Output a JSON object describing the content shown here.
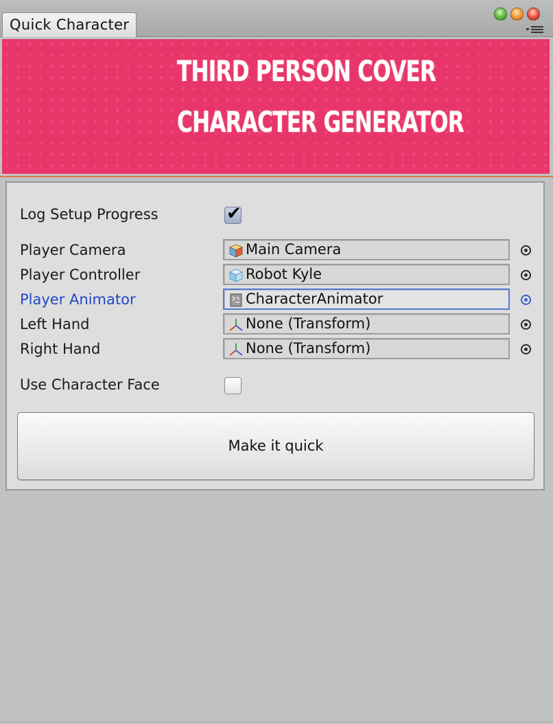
{
  "window": {
    "tab_title": "Quick Character",
    "colors": {
      "banner_bg": "#e8356a",
      "focus_blue": "#2247c8"
    }
  },
  "banner": {
    "line1": "THIRD PERSON COVER",
    "line2": "CHARACTER GENERATOR"
  },
  "form": {
    "log_setup_progress": {
      "label": "Log Setup Progress",
      "checked": true
    },
    "fields": [
      {
        "label": "Player Camera",
        "value": "Main Camera",
        "icon": "camera-gameobject-icon"
      },
      {
        "label": "Player Controller",
        "value": "Robot Kyle",
        "icon": "prefab-cube-icon"
      },
      {
        "label": "Player Animator",
        "value": "CharacterAnimator",
        "icon": "animator-controller-icon",
        "focused": true
      },
      {
        "label": "Left Hand",
        "value": "None (Transform)",
        "icon": "transform-axes-icon"
      },
      {
        "label": "Right Hand",
        "value": "None (Transform)",
        "icon": "transform-axes-icon"
      }
    ],
    "use_character_face": {
      "label": "Use Character Face",
      "checked": false
    },
    "submit_label": "Make it quick"
  }
}
